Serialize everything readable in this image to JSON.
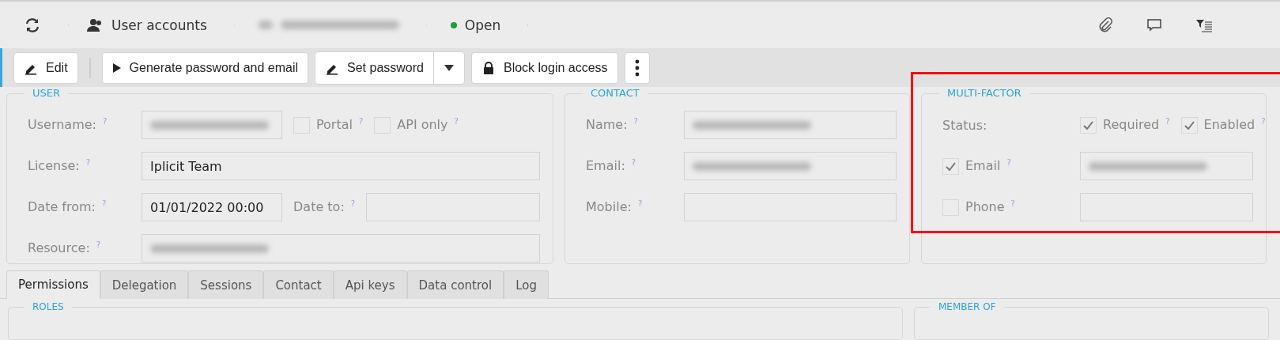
{
  "breadcrumbs": [
    {
      "kind": "refresh"
    },
    {
      "kind": "module",
      "label": "User accounts"
    },
    {
      "kind": "redacted"
    },
    {
      "kind": "status",
      "label": "Open",
      "color": "#1f9d3a"
    }
  ],
  "header_icons": [
    {
      "kind": "attach"
    },
    {
      "kind": "comment"
    },
    {
      "kind": "filter"
    }
  ],
  "actions": [
    {
      "kind": "edit",
      "label": "Edit"
    },
    {
      "kind": "separator"
    },
    {
      "kind": "run",
      "label": "Generate password and email"
    },
    {
      "kind": "split",
      "label": "Set password"
    },
    {
      "kind": "lock",
      "label": "Block login access"
    },
    {
      "kind": "more"
    }
  ],
  "sections": [
    {
      "title": "USER",
      "rows": [
        [
          {
            "kind": "label",
            "text": "Username:",
            "help": "?"
          },
          {
            "kind": "input",
            "redacted": true
          },
          {
            "kind": "checkbox",
            "text": "Portal",
            "help": "?",
            "checked": false
          },
          {
            "kind": "checkbox",
            "text": "API only",
            "help": "?",
            "checked": false
          }
        ],
        [
          {
            "kind": "label",
            "text": "License:",
            "help": "?"
          },
          {
            "kind": "input",
            "value": "Iplicit Team"
          }
        ],
        [
          {
            "kind": "label",
            "text": "Date from:",
            "help": "?"
          },
          {
            "kind": "input",
            "value": "01/01/2022 00:00"
          },
          {
            "kind": "label",
            "text": "Date to:",
            "help": "?"
          },
          {
            "kind": "input"
          }
        ],
        [
          {
            "kind": "label",
            "text": "Resource:",
            "help": "?"
          },
          {
            "kind": "input",
            "redacted": true
          }
        ]
      ]
    },
    {
      "title": "CONTACT",
      "rows": [
        [
          {
            "kind": "label",
            "text": "Name:",
            "help": "?"
          },
          {
            "kind": "input",
            "redacted": true
          }
        ],
        [
          {
            "kind": "label",
            "text": "Email:",
            "help": "?"
          },
          {
            "kind": "input",
            "redacted": true
          }
        ],
        [
          {
            "kind": "label",
            "text": "Mobile:",
            "help": "?"
          },
          {
            "kind": "input"
          }
        ]
      ]
    },
    {
      "title": "MULTI-FACTOR",
      "highlighted": true,
      "rows": [
        [
          {
            "kind": "label",
            "text": "Status:"
          },
          {
            "kind": "checkbox",
            "text": "Required",
            "help": "?",
            "checked": true
          },
          {
            "kind": "checkbox",
            "text": "Enabled",
            "help": "?",
            "checked": true
          }
        ],
        [
          {
            "kind": "checkbox",
            "text": "Email",
            "help": "?",
            "checked": true
          },
          {
            "kind": "input",
            "redacted": true
          }
        ],
        [
          {
            "kind": "checkbox",
            "text": "Phone",
            "help": "?",
            "checked": false
          },
          {
            "kind": "input"
          }
        ]
      ]
    }
  ],
  "tabs": [
    {
      "label": "Permissions",
      "selected": true
    },
    {
      "label": "Delegation",
      "selected": false
    },
    {
      "label": "Sessions",
      "selected": false
    },
    {
      "label": "Contact",
      "selected": false
    },
    {
      "label": "Api keys",
      "selected": false
    },
    {
      "label": "Data control",
      "selected": false
    },
    {
      "label": "Log",
      "selected": false
    }
  ],
  "bottom_sections": [
    "ROLES",
    "MEMBER OF"
  ]
}
